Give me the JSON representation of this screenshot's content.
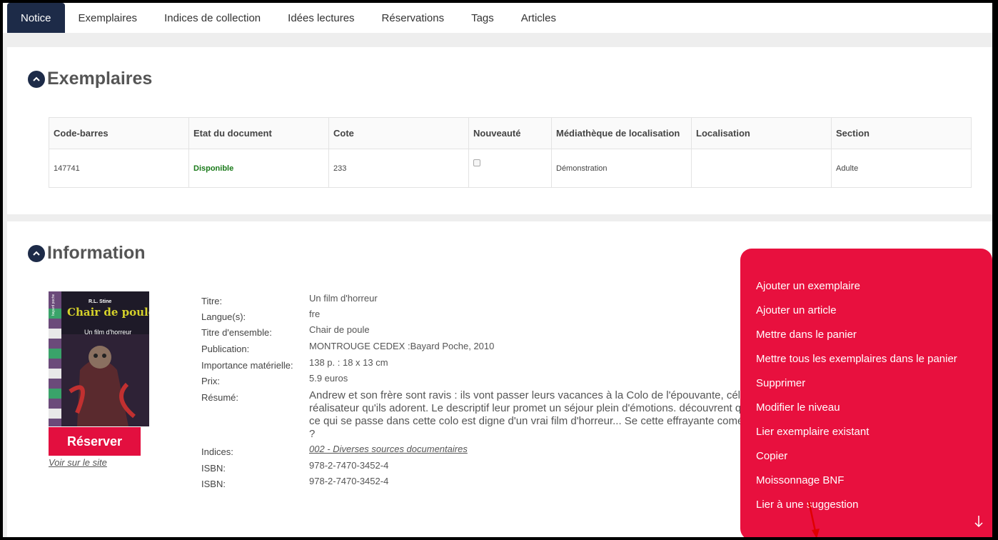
{
  "tabs": [
    "Notice",
    "Exemplaires",
    "Indices de collection",
    "Idées lectures",
    "Réservations",
    "Tags",
    "Articles"
  ],
  "exemplaires": {
    "title": "Exemplaires",
    "headers": [
      "Code-barres",
      "Etat du document",
      "Cote",
      "Nouveauté",
      "Médiathèque de localisation",
      "Localisation",
      "Section"
    ],
    "row": {
      "code": "147741",
      "etat": "Disponible",
      "cote": "233",
      "mediatheque": "Démonstration",
      "localisation": "",
      "section": "Adulte"
    }
  },
  "information": {
    "title": "Information",
    "cover": {
      "author": "R.L. Stine",
      "series": "Chair de poule",
      "title": "Un film d'horreur",
      "publisher": "bayard poche"
    },
    "reserve_label": "Réserver",
    "site_link": "Voir sur le site",
    "fields": [
      {
        "label": "Titre:",
        "value": "Un film d'horreur"
      },
      {
        "label": "Langue(s):",
        "value": "fre"
      },
      {
        "label": "Titre d'ensemble:",
        "value": "Chair de poule"
      },
      {
        "label": "Publication:",
        "value": "MONTROUGE CEDEX :Bayard Poche, 2010"
      },
      {
        "label": "Importance matérielle:",
        "value": "138 p. : 18 x 13 cm"
      },
      {
        "label": "Prix:",
        "value": "5.9 euros"
      }
    ],
    "resume_label": "Résumé:",
    "resume": "Andrew et son frère sont ravis : ils vont passer leurs vacances à la Colo de l'épouvante, célèbre réalisateur qu'ils adorent. Le descriptif leur promet un séjour plein d'émotions. découvrent que ce qui se passe dans cette colo est digne d'un vrai film d'horreur... Se cette effrayante comédie ?",
    "indices_label": "Indices:",
    "indices_value": "002 - Diverses sources documentaires",
    "isbn_label": "ISBN:",
    "isbn1": "978-2-7470-3452-4",
    "isbn2": "978-2-7470-3452-4"
  },
  "menu": {
    "items": [
      "Ajouter un exemplaire",
      "Ajouter un article",
      "Mettre dans le panier",
      "Mettre tous les exemplaires dans le panier",
      "Supprimer",
      "Modifier le niveau",
      "Lier exemplaire existant",
      "Copier",
      "Moissonnage BNF",
      "Lier à une suggestion"
    ]
  },
  "colors": {
    "navy": "#1d2b48",
    "accent": "#e8103e",
    "available": "#1a7a1a"
  }
}
